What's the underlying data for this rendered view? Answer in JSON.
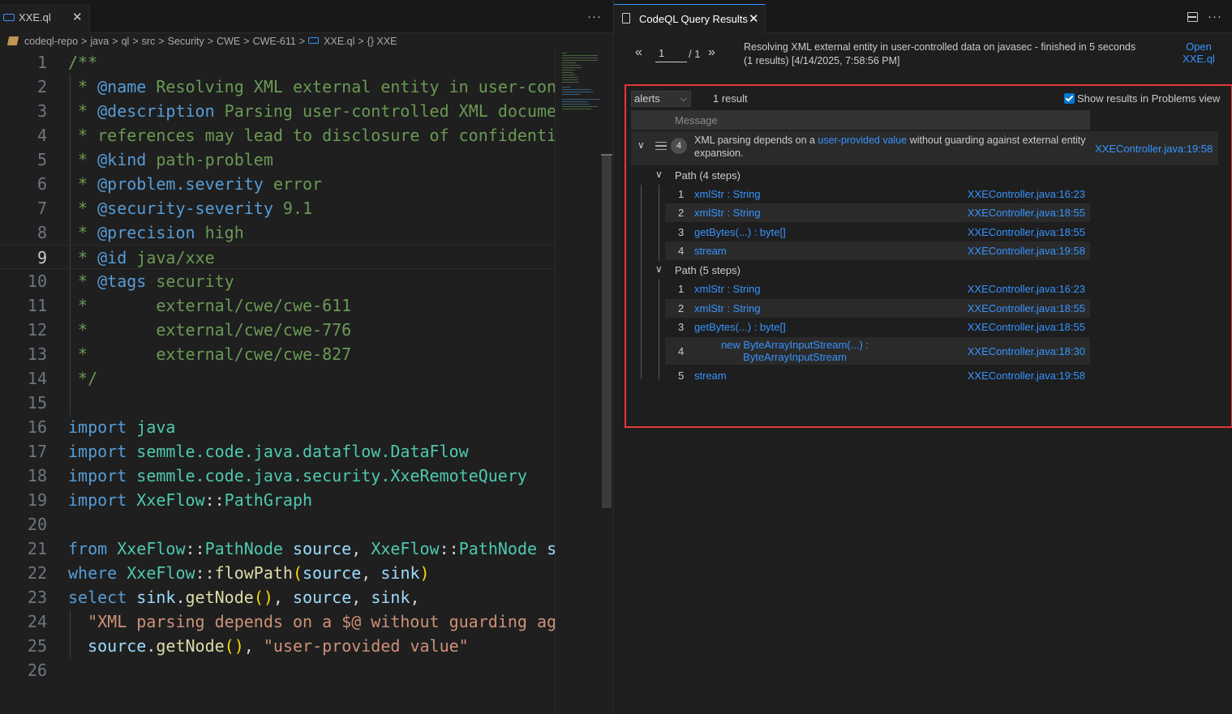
{
  "editor": {
    "tab": {
      "label": "XXE.ql",
      "close": "✕"
    },
    "more": "···",
    "breadcrumb": {
      "items": [
        "codeql-repo",
        "java",
        "ql",
        "src",
        "Security",
        "CWE",
        "CWE-611",
        "XXE.ql",
        "{} XXE"
      ],
      "separator": ">"
    },
    "lines": [
      {
        "n": "1"
      },
      {
        "n": "2"
      },
      {
        "n": "3"
      },
      {
        "n": "4"
      },
      {
        "n": "5"
      },
      {
        "n": "6"
      },
      {
        "n": "7"
      },
      {
        "n": "8"
      },
      {
        "n": "9"
      },
      {
        "n": "10"
      },
      {
        "n": "11"
      },
      {
        "n": "12"
      },
      {
        "n": "13"
      },
      {
        "n": "14"
      },
      {
        "n": "15"
      },
      {
        "n": "16"
      },
      {
        "n": "17"
      },
      {
        "n": "18"
      },
      {
        "n": "19"
      },
      {
        "n": "20"
      },
      {
        "n": "21"
      },
      {
        "n": "22"
      },
      {
        "n": "23"
      },
      {
        "n": "24"
      },
      {
        "n": "25"
      },
      {
        "n": "26"
      }
    ],
    "active_line": 9,
    "code": {
      "l1": "/**",
      "l2_a": " * ",
      "l2_tag": "@name",
      "l2_b": " Resolving XML external entity in user-con",
      "l3_a": " * ",
      "l3_tag": "@description",
      "l3_b": " Parsing user-controlled XML docume",
      "l4": " * references may lead to disclosure of confidenti",
      "l5_a": " * ",
      "l5_tag": "@kind",
      "l5_b": " path-problem",
      "l6_a": " * ",
      "l6_tag": "@problem.severity",
      "l6_b": " error",
      "l7_a": " * ",
      "l7_tag": "@security-severity",
      "l7_b": " 9.1",
      "l8_a": " * ",
      "l8_tag": "@precision",
      "l8_b": " high",
      "l9_a": " * ",
      "l9_tag": "@id",
      "l9_b": " java/xxe",
      "l10_a": " * ",
      "l10_tag": "@tags",
      "l10_b": " security",
      "l11": " *       external/cwe/cwe-611",
      "l12": " *       external/cwe/cwe-776",
      "l13": " *       external/cwe/cwe-827",
      "l14": " */",
      "l16_kw": "import",
      "l16_b": " java",
      "l17_kw": "import",
      "l17_b": " semmle.code.java.dataflow.",
      "l17_c": "DataFlow",
      "l18_kw": "import",
      "l18_b": " semmle.code.java.security.",
      "l18_c": "XxeRemoteQuery",
      "l19_kw": "import",
      "l19_t1": " XxeFlow",
      "l19_p": "::",
      "l19_t2": "PathGraph",
      "l21_kw": "from",
      "l21_t1": " XxeFlow",
      "l21_p1": "::",
      "l21_t2": "PathNode",
      "l21_v1": " source",
      "l21_p2": ", ",
      "l21_t3": "XxeFlow",
      "l21_p3": "::",
      "l21_t4": "PathNode",
      "l21_v2": " s",
      "l22_kw": "where",
      "l22_t1": " XxeFlow",
      "l22_p1": "::",
      "l22_f": "flowPath",
      "l22_b1": "(",
      "l22_v1": "source",
      "l22_p2": ", ",
      "l22_v2": "sink",
      "l22_b2": ")",
      "l23_kw": "select",
      "l23_v1": " sink",
      "l23_p1": ".",
      "l23_f": "getNode",
      "l23_b": "()",
      "l23_p2": ", ",
      "l23_v2": "source",
      "l23_p3": ", ",
      "l23_v3": "sink",
      "l23_p4": ",",
      "l24_s": "  \"XML parsing depends on a $@ without guarding ag",
      "l25_v": "  source",
      "l25_p1": ".",
      "l25_f": "getNode",
      "l25_b": "()",
      "l25_p2": ", ",
      "l25_s": "\"user-provided value\""
    }
  },
  "results": {
    "tab": {
      "label": "CodeQL Query Results",
      "close": "✕"
    },
    "more": "···",
    "pager": {
      "prev": "«",
      "page": "1",
      "total": "/ 1",
      "next": "»"
    },
    "summary_line1": "Resolving XML external entity in user-controlled data on javasec - finished in 5 seconds",
    "summary_line2": "(1 results) [4/14/2025, 7:58:56 PM]",
    "open_link_line1": "Open",
    "open_link_line2": "XXE.ql",
    "result_set": "alerts",
    "result_count": "1 result",
    "problems_label": "Show results in Problems view",
    "problems_checked": true,
    "column_message": "Message",
    "alert": {
      "badge": "4",
      "msg_before": "XML parsing depends on a ",
      "msg_link": "user-provided value",
      "msg_after": " without guarding against external entity expansion.",
      "location": "XXEController.java:19:58"
    },
    "paths": [
      {
        "label": "Path (4 steps)",
        "steps": [
          {
            "num": "1",
            "node": "xmlStr : String",
            "loc": "XXEController.java:16:23"
          },
          {
            "num": "2",
            "node": "xmlStr : String",
            "loc": "XXEController.java:18:55"
          },
          {
            "num": "3",
            "node": "getBytes(...) : byte[]",
            "loc": "XXEController.java:18:55"
          },
          {
            "num": "4",
            "node": "stream",
            "loc": "XXEController.java:19:58"
          }
        ]
      },
      {
        "label": "Path (5 steps)",
        "steps": [
          {
            "num": "1",
            "node": "xmlStr : String",
            "loc": "XXEController.java:16:23"
          },
          {
            "num": "2",
            "node": "xmlStr : String",
            "loc": "XXEController.java:18:55"
          },
          {
            "num": "3",
            "node": "getBytes(...) : byte[]",
            "loc": "XXEController.java:18:55"
          },
          {
            "num": "4",
            "node_line1": "new ByteArrayInputStream(...) :",
            "node_line2": "ByteArrayInputStream",
            "loc": "XXEController.java:18:30"
          },
          {
            "num": "5",
            "node": "stream",
            "loc": "XXEController.java:19:58"
          }
        ]
      }
    ]
  },
  "colors": {
    "accent": "#3794ff",
    "highlight_border": "#e5363b",
    "comment": "#6a9955",
    "keyword": "#569cd6",
    "type": "#4ec9b0",
    "string": "#ce9178"
  }
}
